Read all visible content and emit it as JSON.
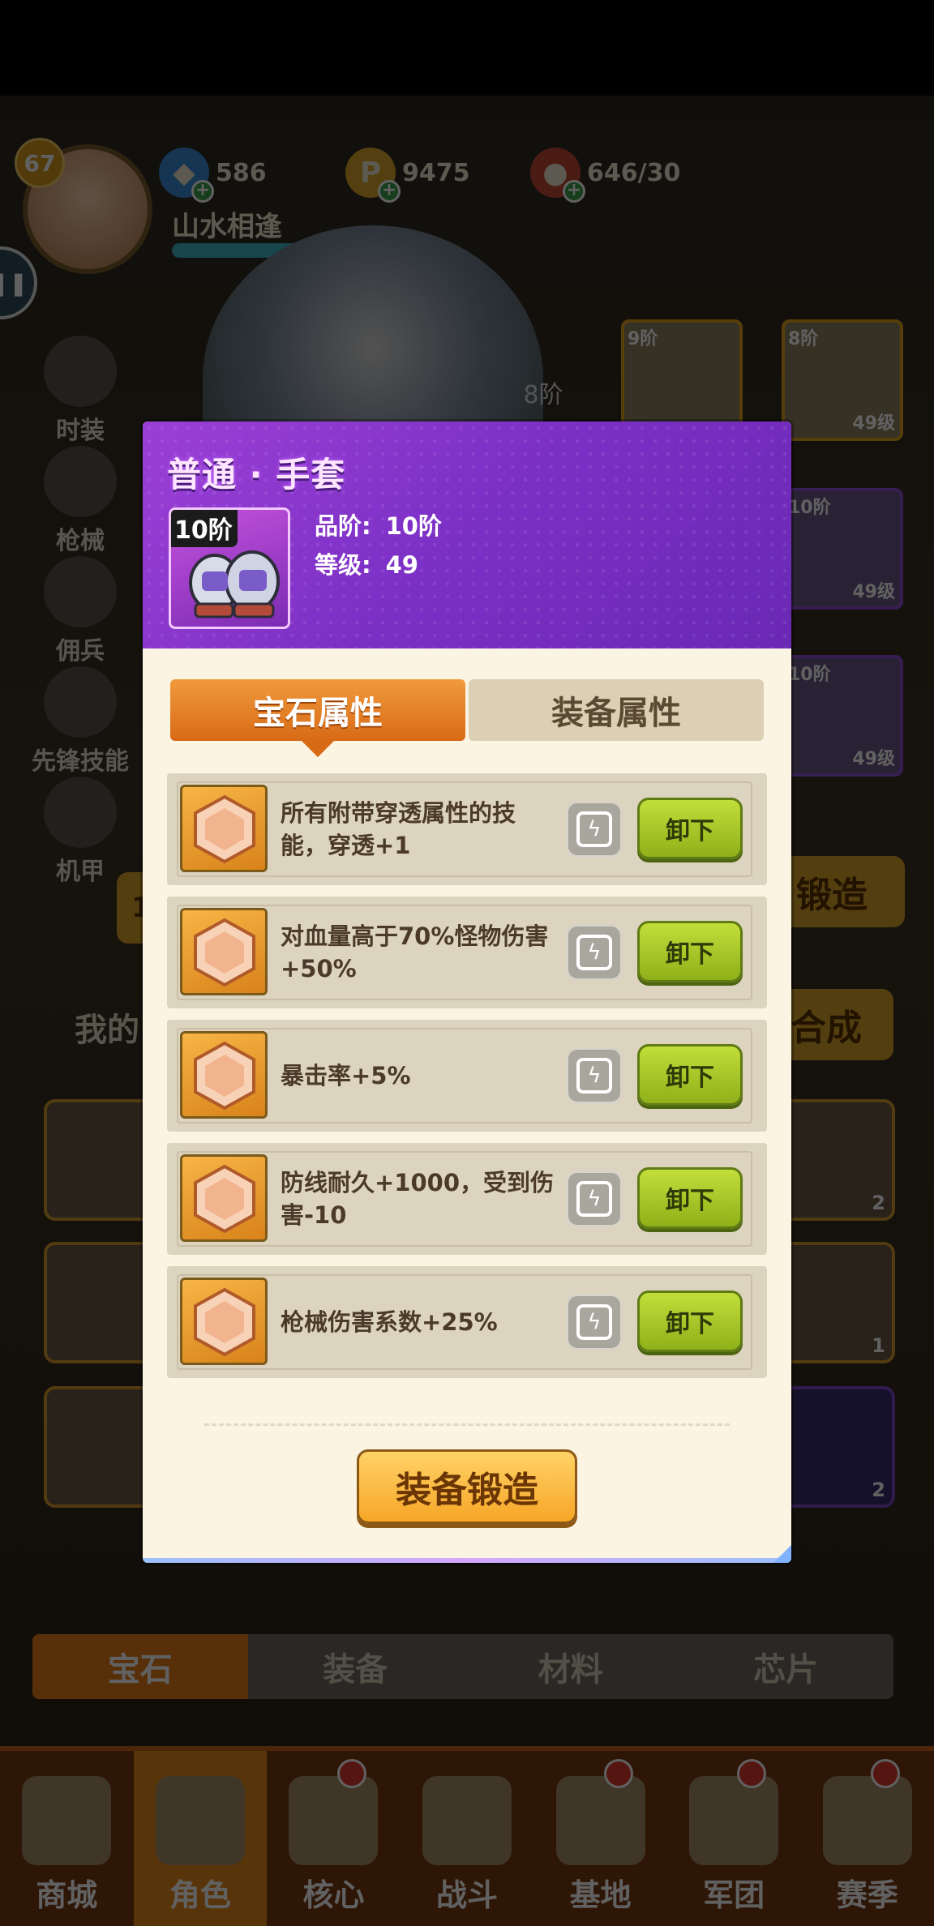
{
  "player": {
    "level": "67",
    "name": "山水相逢",
    "gems": "586",
    "coins": "9475",
    "stamina": "646/30"
  },
  "side_menu": [
    "时装",
    "枪械",
    "佣兵",
    "先锋技能",
    "机甲"
  ],
  "hero_rank": "8阶",
  "equip_slots": [
    {
      "tier": "9阶",
      "level": ""
    },
    {
      "tier": "8阶",
      "level": "49级"
    },
    {
      "tier": "10阶",
      "level": "49级"
    },
    {
      "tier": "10阶",
      "level": "49级"
    }
  ],
  "background": {
    "forge_label": "锻造",
    "synth_label": "合成",
    "mine_label": "我的",
    "page_num": "1",
    "gem_counts": [
      "2",
      "1",
      "2"
    ],
    "tabs": [
      "宝石",
      "装备",
      "材料",
      "芯片"
    ]
  },
  "nav": [
    "商城",
    "角色",
    "核心",
    "战斗",
    "基地",
    "军团",
    "赛季"
  ],
  "modal": {
    "title": "普通 · 手套",
    "item_tier": "10阶",
    "grade_label": "品阶:",
    "grade_value": "10阶",
    "level_label": "等级:",
    "level_value": "49",
    "tabs": [
      "宝石属性",
      "装备属性"
    ],
    "gems": [
      {
        "text": "所有附带穿透属性的技能，穿透+1",
        "button": "卸下"
      },
      {
        "text": "对血量高于70%怪物伤害+50%",
        "button": "卸下"
      },
      {
        "text": "暴击率+5%",
        "button": "卸下"
      },
      {
        "text": "防线耐久+1000，受到伤害-10",
        "button": "卸下"
      },
      {
        "text": "枪械伤害系数+25%",
        "button": "卸下"
      }
    ],
    "forge_button": "装备锻造"
  },
  "colors": {
    "header_purple": "#7b30c5",
    "tab_active": "#e07a20",
    "unequip_green": "#a8c82a",
    "forge_gold": "#f7b23a",
    "panel_cream": "#fbf4e3"
  }
}
